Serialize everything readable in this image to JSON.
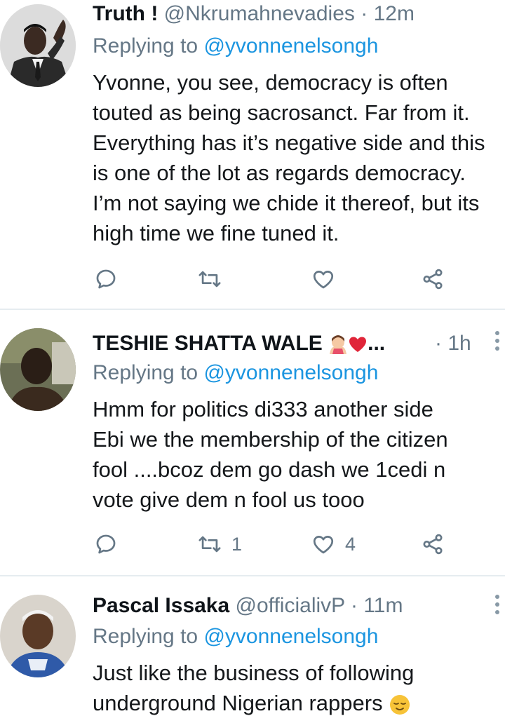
{
  "tweets": [
    {
      "name": "Truth !",
      "handle": "@Nkrumahnevadies",
      "time": "12m",
      "replying_prefix": "Replying to",
      "replying_to": "@yvonnenelsongh",
      "lines": [
        "Yvonne, you see, democracy is often",
        "touted as being sacrosanct. Far from it.",
        "Everything has it’s negative side and this",
        "is one of the lot as regards democracy.",
        "I’m not saying we chide it thereof, but its",
        "high time we fine tuned it."
      ],
      "retweets": "",
      "likes": ""
    },
    {
      "name": "TESHIE SHATTA WALE",
      "name_suffix": "...",
      "handle": "",
      "time": "1h",
      "replying_prefix": "Replying to",
      "replying_to": "@yvonnenelsongh",
      "lines": [
        "Hmm for politics di333 another  side",
        "Ebi we the membership of the citizen",
        "fool ....bcoz dem go dash we 1cedi n",
        "vote give dem n fool us tooo"
      ],
      "retweets": "1",
      "likes": "4"
    },
    {
      "name": "Pascal Issaka",
      "handle": "@officialivP",
      "time": "11m",
      "replying_prefix": "Replying to",
      "replying_to": "@yvonnenelsongh",
      "lines": [
        "Just like the business of following",
        "underground Nigerian rappers"
      ],
      "retweets": "",
      "likes": ""
    }
  ],
  "icons": {
    "reply": "reply-icon",
    "retweet": "retweet-icon",
    "like": "heart-icon",
    "share": "share-icon",
    "more": "more-vertical-icon"
  },
  "colors": {
    "text": "#14171a",
    "secondary": "#657786",
    "mention": "#1b95e0",
    "divider": "#e6ecf0"
  }
}
